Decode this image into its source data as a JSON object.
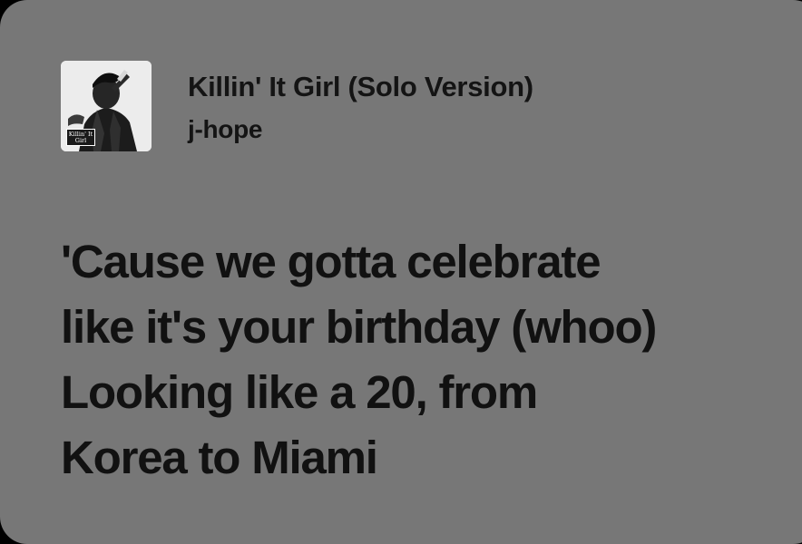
{
  "track": {
    "title": "Killin' It Girl (Solo Version)",
    "artist": "j-hope",
    "album_art": {
      "badge_text": "Killin' It\nGirl"
    }
  },
  "lyrics": [
    "'Cause we gotta celebrate",
    "like it's your birthday (whoo)",
    "Looking like a 20, from",
    "Korea to Miami"
  ],
  "colors": {
    "card_background": "#777777",
    "text": "#141414",
    "frame": "#000000"
  }
}
